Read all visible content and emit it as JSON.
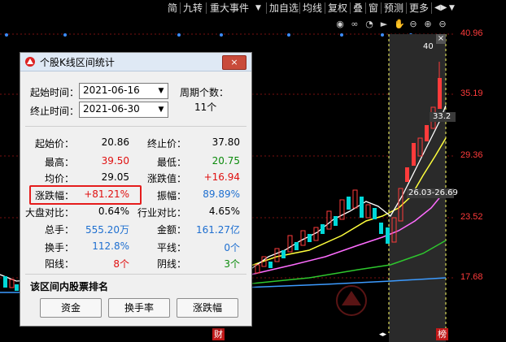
{
  "toolbar": {
    "items": [
      "简",
      "九转",
      "重大事件",
      "▼",
      "加自选",
      "均线",
      "复权",
      "叠",
      "窗",
      "预测",
      "更多",
      "◀▶",
      "▼"
    ]
  },
  "axis": {
    "labels": [
      "40.96",
      "35.19",
      "29.36",
      "23.52",
      "17.68"
    ],
    "top_marker": "40",
    "price_tag_1": "33.2",
    "price_tag_2": "26.03-26.69"
  },
  "bottom_tags": {
    "left": "财",
    "right": "榜"
  },
  "chart_icons": [
    "eye-icon",
    "infinity-icon",
    "clock-icon",
    "play-icon",
    "hand-icon",
    "search-minus-icon",
    "plus-icon",
    "minus-icon"
  ],
  "dialog": {
    "title": "个股K线区间统计",
    "close_label": "×",
    "start_label": "起始时间：",
    "start_value": "2021-06-16",
    "end_label": "终止时间：",
    "end_value": "2021-06-30",
    "period_label": "周期个数：",
    "period_value": "11个",
    "stats": {
      "start_price_label": "起始价：",
      "start_price": "20.86",
      "end_price_label": "终止价：",
      "end_price": "37.80",
      "high_label": "最高：",
      "high": "39.50",
      "low_label": "最低：",
      "low": "20.75",
      "avg_label": "均价：",
      "avg": "29.05",
      "change_label": "涨跌值：",
      "change": "+16.94",
      "pct_label": "涨跌幅：",
      "pct": "+81.21%",
      "amp_label": "振幅：",
      "amp": "89.89%",
      "market_label": "大盘对比：",
      "market": "0.64%",
      "industry_label": "行业对比：",
      "industry": "4.65%",
      "vol_label": "总手：",
      "vol": "555.20万",
      "amount_label": "金额：",
      "amount": "161.27亿",
      "turnover_label": "换手：",
      "turnover": "112.8%",
      "flat_label": "平线：",
      "flat": "0个",
      "up_label": "阳线：",
      "up": "8个",
      "down_label": "阴线：",
      "down": "3个"
    },
    "rank_title": "该区间内股票排名",
    "rank_buttons": [
      "资金",
      "换手率",
      "涨跌幅"
    ]
  },
  "colors": {
    "up": "#ff3b3b",
    "down": "#00d8d8",
    "ma5": "#ffffff",
    "ma10": "#ffff3c",
    "ma20": "#ff6cff",
    "ma60": "#2ec82e",
    "ma120": "#3c9bff"
  }
}
